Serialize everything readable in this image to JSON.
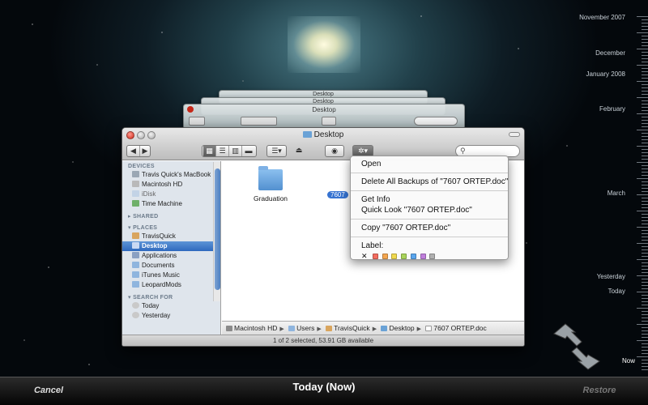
{
  "window": {
    "title": "Desktop",
    "status": "1 of 2 selected, 53.91 GB available",
    "search_placeholder": ""
  },
  "ghost_windows": [
    {
      "title": "Desktop"
    },
    {
      "title": "Desktop"
    },
    {
      "title": "Desktop"
    }
  ],
  "sidebar": {
    "devices_header": "DEVICES",
    "devices": [
      "Travis Quick's MacBook",
      "Macintosh HD",
      "iDisk",
      "Time Machine"
    ],
    "shared_header": "SHARED",
    "places_header": "PLACES",
    "places": [
      "TravisQuick",
      "Desktop",
      "Applications",
      "Documents",
      "iTunes Music",
      "LeopardMods"
    ],
    "search_header": "SEARCH FOR",
    "search_items": [
      "Today",
      "Yesterday"
    ]
  },
  "files": [
    {
      "name": "Graduation",
      "icon": "folder-icon"
    },
    {
      "name": "7607",
      "icon": "document-icon",
      "selected": true
    }
  ],
  "pathbar": [
    "Macintosh HD",
    "Users",
    "TravisQuick",
    "Desktop",
    "7607 ORTEP.doc"
  ],
  "context_menu": {
    "open": "Open",
    "delete_backups": "Delete All Backups of \"7607 ORTEP.doc\"",
    "get_info": "Get Info",
    "quick_look": "Quick Look \"7607 ORTEP.doc\"",
    "copy": "Copy \"7607 ORTEP.doc\"",
    "label": "Label:",
    "label_colors": [
      "#f36c5f",
      "#f4a64f",
      "#f0d94e",
      "#a9d45a",
      "#5aa6ee",
      "#c07fdc",
      "#b0b0b0"
    ]
  },
  "timeline": {
    "labels": [
      "November 2007",
      "December",
      "January 2008",
      "February",
      "March",
      "Yesterday",
      "Today",
      "Now"
    ]
  },
  "bottom_bar": {
    "cancel": "Cancel",
    "title": "Today (Now)",
    "restore": "Restore"
  }
}
